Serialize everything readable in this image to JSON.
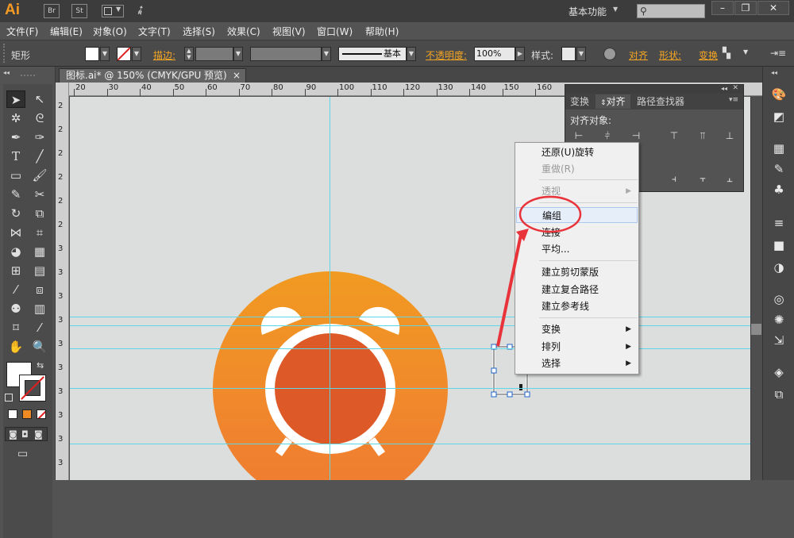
{
  "app": {
    "logo": "Ai",
    "bridge": "Br",
    "stock": "St",
    "workspace": "基本功能",
    "search_placeholder": ""
  },
  "menubar": {
    "items": [
      "文件(F)",
      "编辑(E)",
      "对象(O)",
      "文字(T)",
      "选择(S)",
      "效果(C)",
      "视图(V)",
      "窗口(W)",
      "帮助(H)"
    ]
  },
  "controlbar": {
    "selection_label": "矩形",
    "stroke_label": "描边:",
    "brush_profile": "基本",
    "opacity_label": "不透明度:",
    "opacity_value": "100%",
    "style_label": "样式:",
    "align_link": "对齐",
    "shape_link": "形状:",
    "transform_link": "变换"
  },
  "document": {
    "tab_title": "图标.ai* @ 150% (CMYK/GPU 预览)",
    "close_glyph": "×"
  },
  "ruler": {
    "h_ticks": [
      "20",
      "30",
      "40",
      "50",
      "60",
      "70",
      "80",
      "90",
      "100",
      "110",
      "120",
      "130",
      "140",
      "150",
      "160"
    ],
    "v_ticks": [
      "2",
      "2",
      "2",
      "2",
      "2",
      "2",
      "3",
      "3",
      "3",
      "3",
      "3",
      "3",
      "3",
      "3",
      "3",
      "3"
    ]
  },
  "align_panel": {
    "tabs": [
      "变换",
      "对齐",
      "路径查找器"
    ],
    "active_tab": "对齐",
    "align_to_label": "对齐对象:"
  },
  "context_menu": {
    "items": [
      {
        "label": "还原(U)旋转",
        "enabled": true,
        "submenu": false
      },
      {
        "label": "重做(R)",
        "enabled": false,
        "submenu": false
      },
      {
        "label": "透视",
        "enabled": false,
        "submenu": true
      },
      {
        "label": "编组",
        "enabled": true,
        "submenu": false,
        "highlighted": true
      },
      {
        "label": "连接",
        "enabled": true,
        "submenu": false
      },
      {
        "label": "平均...",
        "enabled": true,
        "submenu": false
      },
      {
        "label": "建立剪切蒙版",
        "enabled": true,
        "submenu": false
      },
      {
        "label": "建立复合路径",
        "enabled": true,
        "submenu": false
      },
      {
        "label": "建立参考线",
        "enabled": true,
        "submenu": false
      },
      {
        "label": "变换",
        "enabled": true,
        "submenu": true
      },
      {
        "label": "排列",
        "enabled": true,
        "submenu": true
      },
      {
        "label": "选择",
        "enabled": true,
        "submenu": true
      }
    ],
    "submenu_glyph": "▶"
  },
  "colors": {
    "accent": "#f59a23",
    "icon_orange_top": "#f19a22",
    "icon_orange_bottom": "#ef7a33",
    "clock_face": "#dd5a28",
    "guide": "#5fd6e6",
    "annotation_red": "#e8333a"
  },
  "icons": {
    "tools": [
      "selection-tool",
      "direct-selection-tool",
      "magic-wand-tool",
      "lasso-tool",
      "pen-tool",
      "curvature-tool",
      "type-tool",
      "line-tool",
      "rectangle-tool",
      "paintbrush-tool",
      "pencil-tool",
      "scissors-tool",
      "rotate-tool",
      "scale-tool",
      "width-tool",
      "free-transform-tool",
      "shape-builder-tool",
      "perspective-grid-tool",
      "mesh-tool",
      "gradient-tool",
      "eyedropper-tool",
      "blend-tool",
      "symbol-sprayer-tool",
      "column-graph-tool",
      "artboard-tool",
      "slice-tool",
      "hand-tool",
      "zoom-tool"
    ],
    "dock": [
      "color-icon",
      "color-guide-icon",
      "swatches-icon",
      "brushes-icon",
      "symbols-icon",
      "stroke-icon",
      "gradient-icon",
      "transparency-icon",
      "appearance-icon",
      "graphic-styles-icon",
      "export-icon",
      "layers-icon",
      "artboards-icon"
    ]
  }
}
